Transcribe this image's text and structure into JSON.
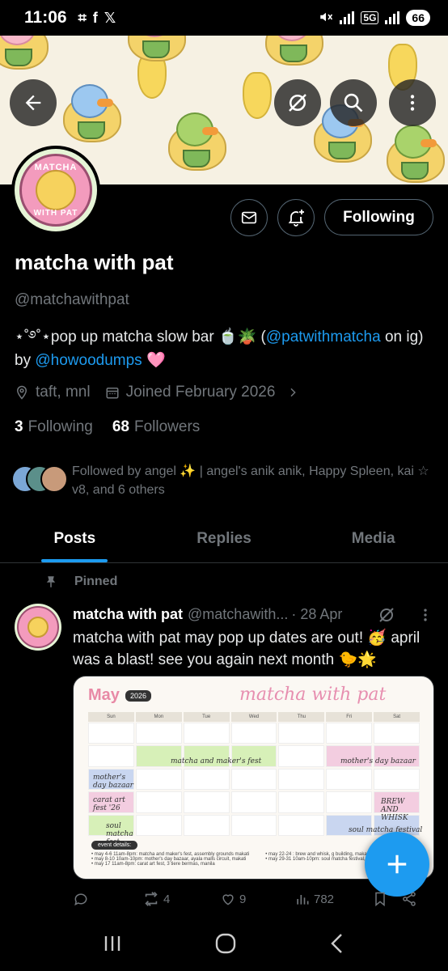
{
  "status_bar": {
    "time": "11:06",
    "battery": "66",
    "network": "5G"
  },
  "banner": {
    "buttons": [
      "back-arrow-icon",
      "translate-off-icon",
      "search-icon",
      "more-icon"
    ]
  },
  "profile": {
    "name": "matcha with pat",
    "handle": "@matchawithpat",
    "bio": {
      "before": "⋆˚࿔˚⋆pop up matcha slow bar 🍵🪴 (",
      "link1": "@patwithmatcha",
      "middle1": " on ig) by ",
      "link2": "@howoodumps",
      "after": " 🩷"
    },
    "location": "taft, mnl",
    "joined": "Joined February 2026",
    "following_count": "3",
    "following_label": "Following",
    "followers_count": "68",
    "followers_label": "Followers",
    "followed_by": "Followed by angel ✨ | angel's anik anik, Happy Spleen, kai ☆ v8, and 6 others",
    "follow_button": "Following",
    "avatar_text_top": "MATCHA",
    "avatar_text_bottom": "WITH PAT"
  },
  "tabs": [
    {
      "label": "Posts",
      "active": true
    },
    {
      "label": "Replies",
      "active": false
    },
    {
      "label": "Media",
      "active": false
    }
  ],
  "tweet": {
    "pinned_label": "Pinned",
    "author": "matcha with pat",
    "handle": "@matchawith...",
    "date": "· 28 Apr",
    "text": "matcha with pat may pop up dates are out! 🥳 april was a blast! see you again next month 🐤🌟",
    "media": {
      "month": "May",
      "year": "2026",
      "title": "matcha with pat",
      "days": [
        "Sun",
        "Mon",
        "Tue",
        "Wed",
        "Thu",
        "Fri",
        "Sat"
      ],
      "labels": {
        "maker_fest": "matcha and maker's fest",
        "mothers_bazaar_1": "mother's day bazaar",
        "mothers_bazaar_2": "mother's day bazaar",
        "carat_fest": "carat art fest '26",
        "brew_whisk": "BREW AND WHISK",
        "soul_fest": "soul matcha festival",
        "soul_fest_2": "soul matcha fest"
      },
      "details_pill": "event details:",
      "details_lines": [
        "• may 4-6 11am-8pm: matcha and maker's fest, assembly grounds makati",
        "• may 8-10 10am-10pm: mother's day bazaar, ayala malls circuit, makati",
        "• may 17 11am-8pm: carat art fest, 3 tiere bermas, manila",
        "• may 22-24 : brew and whisk, g building, makati",
        "• may 29-31 10am-10pm: soul matcha festival, glorietta park"
      ]
    },
    "replies": "",
    "reposts": "4",
    "likes": "9",
    "views": "782"
  },
  "colors": {
    "accent": "#1d9bf0",
    "background": "#000000",
    "text_secondary": "#71767b",
    "border": "#2f3336"
  }
}
